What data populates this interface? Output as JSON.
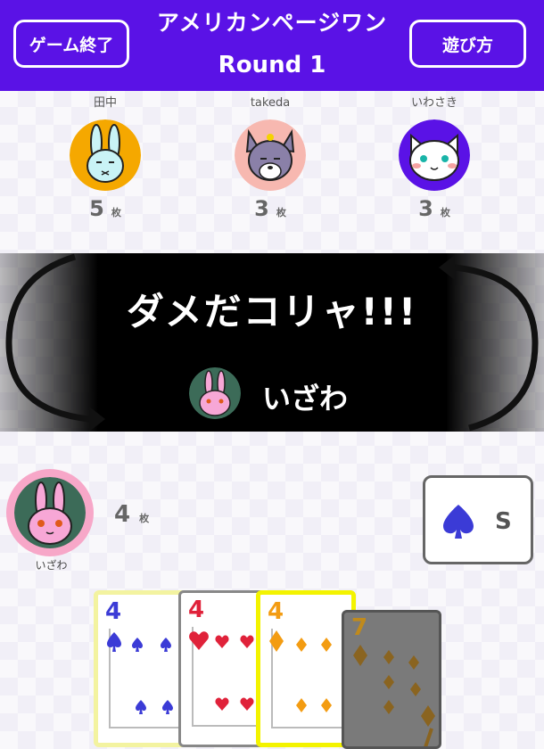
{
  "header": {
    "title": "アメリカンページワン",
    "round": "Round 1",
    "end_button": "ゲーム終了",
    "howto_button": "遊び方",
    "bg_color": "#5a12e6"
  },
  "opponents": [
    {
      "name": "田中",
      "count": "5",
      "unit": "枚",
      "avatar": "rabbit-avatar",
      "avatar_bg": "#f5a800"
    },
    {
      "name": "takeda",
      "count": "3",
      "unit": "枚",
      "avatar": "wolf-avatar",
      "avatar_bg": "#f7b8b0"
    },
    {
      "name": "いわさき",
      "count": "3",
      "unit": "枚",
      "avatar": "cat-avatar",
      "avatar_bg": "#5a12e6"
    }
  ],
  "banner": {
    "message": "ダメだコリャ!!!",
    "player_name": "いざわ"
  },
  "me": {
    "name": "いざわ",
    "count": "4",
    "unit": "枚"
  },
  "current_suit": {
    "label": "S",
    "icon": "spade-icon",
    "color": "#3b3bd6"
  },
  "hand": [
    {
      "rank": "4",
      "suit": "spade",
      "color": "#3b3bd6"
    },
    {
      "rank": "4",
      "suit": "heart",
      "color": "#e0223a"
    },
    {
      "rank": "4",
      "suit": "diamond",
      "color": "#f39c12"
    },
    {
      "rank": "7",
      "suit": "diamond",
      "color": "#c08a1c"
    }
  ]
}
